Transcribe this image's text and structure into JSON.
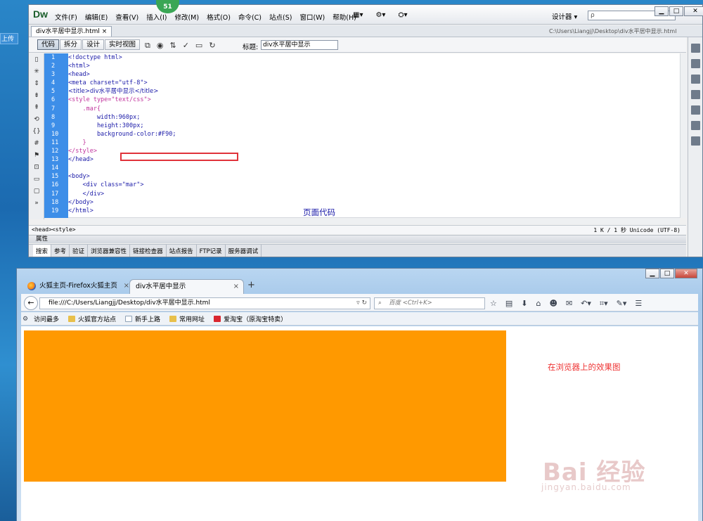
{
  "desktop": {
    "upload_label": "上传"
  },
  "dreamweaver": {
    "logo": "Dw",
    "notification_count": "51",
    "menus": [
      "文件(F)",
      "编辑(E)",
      "查看(V)",
      "插入(I)",
      "修改(M)",
      "格式(O)",
      "命令(C)",
      "站点(S)",
      "窗口(W)",
      "帮助(H)"
    ],
    "workspace": "设计器",
    "search_placeholder": "ρ",
    "doc_tab": "div水平居中显示.html",
    "doc_path": "C:\\Users\\Liangjj\\Desktop\\div水平居中显示.html",
    "view_buttons": [
      "代码",
      "拆分",
      "设计",
      "实时视图"
    ],
    "title_label": "标题:",
    "title_value": "div水平居中显示",
    "line_numbers": [
      "1",
      "2",
      "3",
      "4",
      "5",
      "6",
      "7",
      "8",
      "9",
      "10",
      "11",
      "12",
      "13",
      "14",
      "15",
      "16",
      "17",
      "18",
      "19"
    ],
    "code_lines": [
      "<!doctype html>",
      "<html>",
      "<head>",
      "<meta charset=\"utf-8\">",
      "<title>div水平居中显示</title>",
      "<style type=\"text/css\">",
      "    .mar{",
      "        width:960px;",
      "        height:300px;",
      "        background-color:#F90;",
      "    }",
      "</style>",
      "</head>",
      "",
      "<body>",
      "    <div class=\"mar\">",
      "    </div>",
      "</body>",
      "</html>"
    ],
    "annotation": "页面代码",
    "status_tags": "<head><style>",
    "status_info": "1 K / 1 秒  Unicode (UTF-8)",
    "properties_label": "属性",
    "result_tabs": [
      "搜索",
      "参考",
      "验证",
      "浏览器兼容性",
      "链接检查器",
      "站点报告",
      "FTP记录",
      "服务器调试"
    ]
  },
  "firefox": {
    "tabs": [
      {
        "label": "火狐主页-Firefox火狐主页",
        "active": false
      },
      {
        "label": "div水平居中显示",
        "active": true
      }
    ],
    "url": "file:///C:/Users/Liangjj/Desktop/div水平居中显示.html",
    "search_engine": "百度",
    "search_placeholder": "<Ctrl+K>",
    "bookmarks": [
      "访问最多",
      "火狐官方站点",
      "新手上路",
      "常用网址",
      "爱淘宝（原淘宝特卖）"
    ],
    "annotation": "在浏览器上的效果图",
    "box_color": "#ff9900"
  },
  "watermark": {
    "brand": "Bai 经验",
    "url": "jingyan.baidu.com"
  }
}
